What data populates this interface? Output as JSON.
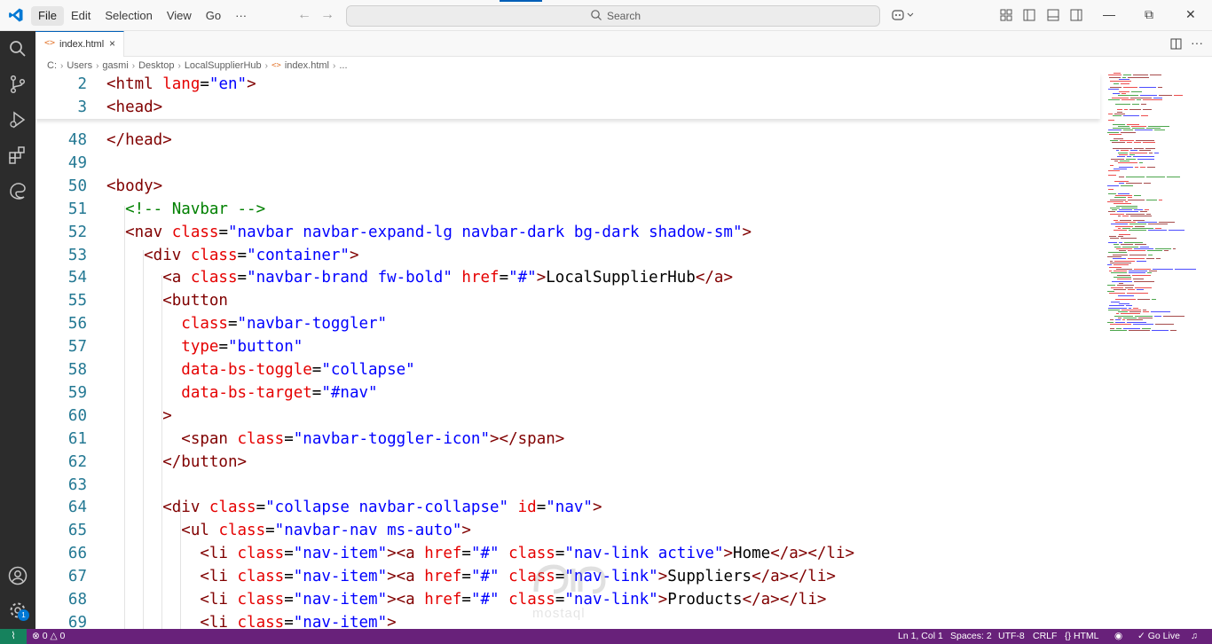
{
  "titlebar": {
    "menu": [
      "File",
      "Edit",
      "Selection",
      "View",
      "Go",
      "···"
    ],
    "search_placeholder": "Search"
  },
  "tab": {
    "label": "index.html",
    "close": "×"
  },
  "breadcrumb": [
    "C:",
    "Users",
    "gasmi",
    "Desktop",
    "LocalSupplierHub",
    "index.html",
    "..."
  ],
  "colors": {
    "activity_bar": "#2c2c2c",
    "status_bar": "#68217a",
    "remote": "#16825d",
    "tag": "#800000",
    "attribute": "#e50000",
    "string": "#0000ff",
    "comment": "#008000",
    "line_number": "#237893"
  },
  "editor": {
    "sticky": [
      {
        "n": "2",
        "code": [
          [
            "t",
            "<html "
          ],
          [
            "a",
            "lang"
          ],
          [
            "p",
            "="
          ],
          [
            "s",
            "\"en\""
          ],
          [
            "t",
            ">"
          ]
        ]
      },
      {
        "n": "3",
        "code": [
          [
            "t",
            "<head>"
          ]
        ]
      }
    ],
    "lines": [
      {
        "n": "48",
        "code": [
          [
            "t",
            "</head>"
          ]
        ]
      },
      {
        "n": "49",
        "code": []
      },
      {
        "n": "50",
        "code": [
          [
            "t",
            "<body>"
          ]
        ]
      },
      {
        "n": "51",
        "code": [
          [
            "c",
            "  <!-- Navbar -->"
          ]
        ]
      },
      {
        "n": "52",
        "code": [
          [
            "t",
            "  <nav "
          ],
          [
            "a",
            "class"
          ],
          [
            "p",
            "="
          ],
          [
            "s",
            "\"navbar navbar-expand-lg navbar-dark bg-dark shadow-sm\""
          ],
          [
            "t",
            ">"
          ]
        ]
      },
      {
        "n": "53",
        "code": [
          [
            "t",
            "    <div "
          ],
          [
            "a",
            "class"
          ],
          [
            "p",
            "="
          ],
          [
            "s",
            "\"container\""
          ],
          [
            "t",
            ">"
          ]
        ]
      },
      {
        "n": "54",
        "code": [
          [
            "t",
            "      <a "
          ],
          [
            "a",
            "class"
          ],
          [
            "p",
            "="
          ],
          [
            "s",
            "\"navbar-brand fw-bold\""
          ],
          [
            "p",
            " "
          ],
          [
            "a",
            "href"
          ],
          [
            "p",
            "="
          ],
          [
            "s",
            "\"#\""
          ],
          [
            "t",
            ">"
          ],
          [
            "p",
            "LocalSupplierHub"
          ],
          [
            "t",
            "</a>"
          ]
        ]
      },
      {
        "n": "55",
        "code": [
          [
            "t",
            "      <button"
          ]
        ]
      },
      {
        "n": "56",
        "code": [
          [
            "a",
            "        class"
          ],
          [
            "p",
            "="
          ],
          [
            "s",
            "\"navbar-toggler\""
          ]
        ]
      },
      {
        "n": "57",
        "code": [
          [
            "a",
            "        type"
          ],
          [
            "p",
            "="
          ],
          [
            "s",
            "\"button\""
          ]
        ]
      },
      {
        "n": "58",
        "code": [
          [
            "a",
            "        data-bs-toggle"
          ],
          [
            "p",
            "="
          ],
          [
            "s",
            "\"collapse\""
          ]
        ]
      },
      {
        "n": "59",
        "code": [
          [
            "a",
            "        data-bs-target"
          ],
          [
            "p",
            "="
          ],
          [
            "s",
            "\"#nav\""
          ]
        ]
      },
      {
        "n": "60",
        "code": [
          [
            "t",
            "      >"
          ]
        ]
      },
      {
        "n": "61",
        "code": [
          [
            "t",
            "        <span "
          ],
          [
            "a",
            "class"
          ],
          [
            "p",
            "="
          ],
          [
            "s",
            "\"navbar-toggler-icon\""
          ],
          [
            "t",
            "></span>"
          ]
        ]
      },
      {
        "n": "62",
        "code": [
          [
            "t",
            "      </button>"
          ]
        ]
      },
      {
        "n": "63",
        "code": []
      },
      {
        "n": "64",
        "code": [
          [
            "t",
            "      <div "
          ],
          [
            "a",
            "class"
          ],
          [
            "p",
            "="
          ],
          [
            "s",
            "\"collapse navbar-collapse\""
          ],
          [
            "p",
            " "
          ],
          [
            "a",
            "id"
          ],
          [
            "p",
            "="
          ],
          [
            "s",
            "\"nav\""
          ],
          [
            "t",
            ">"
          ]
        ]
      },
      {
        "n": "65",
        "code": [
          [
            "t",
            "        <ul "
          ],
          [
            "a",
            "class"
          ],
          [
            "p",
            "="
          ],
          [
            "s",
            "\"navbar-nav ms-auto\""
          ],
          [
            "t",
            ">"
          ]
        ]
      },
      {
        "n": "66",
        "code": [
          [
            "t",
            "          <li "
          ],
          [
            "a",
            "class"
          ],
          [
            "p",
            "="
          ],
          [
            "s",
            "\"nav-item\""
          ],
          [
            "t",
            "><a "
          ],
          [
            "a",
            "href"
          ],
          [
            "p",
            "="
          ],
          [
            "s",
            "\"#\""
          ],
          [
            "p",
            " "
          ],
          [
            "a",
            "class"
          ],
          [
            "p",
            "="
          ],
          [
            "s",
            "\"nav-link active\""
          ],
          [
            "t",
            ">"
          ],
          [
            "p",
            "Home"
          ],
          [
            "t",
            "</a></li>"
          ]
        ]
      },
      {
        "n": "67",
        "code": [
          [
            "t",
            "          <li "
          ],
          [
            "a",
            "class"
          ],
          [
            "p",
            "="
          ],
          [
            "s",
            "\"nav-item\""
          ],
          [
            "t",
            "><a "
          ],
          [
            "a",
            "href"
          ],
          [
            "p",
            "="
          ],
          [
            "s",
            "\"#\""
          ],
          [
            "p",
            " "
          ],
          [
            "a",
            "class"
          ],
          [
            "p",
            "="
          ],
          [
            "s",
            "\"nav-link\""
          ],
          [
            "t",
            ">"
          ],
          [
            "p",
            "Suppliers"
          ],
          [
            "t",
            "</a></li>"
          ]
        ]
      },
      {
        "n": "68",
        "code": [
          [
            "t",
            "          <li "
          ],
          [
            "a",
            "class"
          ],
          [
            "p",
            "="
          ],
          [
            "s",
            "\"nav-item\""
          ],
          [
            "t",
            "><a "
          ],
          [
            "a",
            "href"
          ],
          [
            "p",
            "="
          ],
          [
            "s",
            "\"#\""
          ],
          [
            "p",
            " "
          ],
          [
            "a",
            "class"
          ],
          [
            "p",
            "="
          ],
          [
            "s",
            "\"nav-link\""
          ],
          [
            "t",
            ">"
          ],
          [
            "p",
            "Products"
          ],
          [
            "t",
            "</a></li>"
          ]
        ]
      },
      {
        "n": "69",
        "code": [
          [
            "t",
            "          <li "
          ],
          [
            "a",
            "class"
          ],
          [
            "p",
            "="
          ],
          [
            "s",
            "\"nav-item\""
          ],
          [
            "t",
            ">"
          ]
        ]
      }
    ]
  },
  "watermark": "mostaql",
  "statusbar": {
    "problems": "0",
    "warnings": "0",
    "cursor": "Ln 1, Col 1",
    "spaces": "Spaces: 2",
    "encoding": "UTF-8",
    "eol": "CRLF",
    "language": "HTML",
    "golive": "Go Live",
    "badge": "1"
  }
}
